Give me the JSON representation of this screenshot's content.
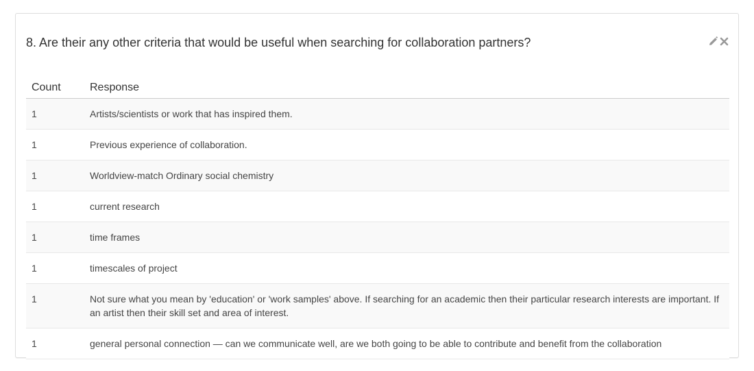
{
  "question": {
    "title": "8. Are their any other criteria that would be useful when searching for collaboration partners?",
    "actions": [
      {
        "icon": "pencil-icon",
        "label": "edit"
      },
      {
        "icon": "close-icon",
        "label": "remove"
      }
    ]
  },
  "colors": {
    "panel_border": "#dddddd",
    "icon": "#999999",
    "stripe": "#f9f9f9"
  },
  "table": {
    "headers": {
      "count": "Count",
      "response": "Response"
    },
    "rows": [
      {
        "count": "1",
        "response": "Artists/scientists or work that has inspired them."
      },
      {
        "count": "1",
        "response": "Previous experience of collaboration."
      },
      {
        "count": "1",
        "response": "Worldview-match Ordinary social chemistry"
      },
      {
        "count": "1",
        "response": "current research"
      },
      {
        "count": "1",
        "response": "time frames"
      },
      {
        "count": "1",
        "response": "timescales of project"
      },
      {
        "count": "1",
        "response": "Not sure what you mean by 'education' or 'work samples' above. If searching for an academic then their particular research interests are important. If an artist then their skill set and area of interest."
      },
      {
        "count": "1",
        "response": "general personal connection — can we communicate well, are we both going to be able to contribute and benefit from the collaboration"
      }
    ]
  }
}
